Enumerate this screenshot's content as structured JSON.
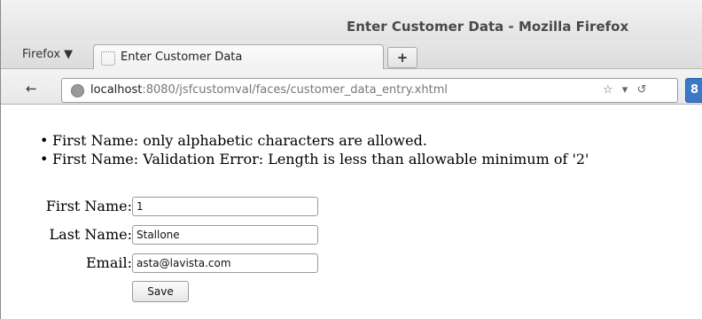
{
  "window": {
    "title": "Enter Customer Data - Mozilla Firefox",
    "firefox_menu": "Firefox ▼"
  },
  "tabs": [
    {
      "label": "Enter Customer Data",
      "active": true
    }
  ],
  "newtab": {
    "label": "+"
  },
  "navbar": {
    "back_icon": "←",
    "url_host": "localhost",
    "url_rest": ":8080/jsfcustomval/faces/customer_data_entry.xhtml",
    "star_icon": "☆",
    "dropdown_icon": "▾",
    "reload_icon": "↺",
    "search_engine_letter": "8"
  },
  "page": {
    "errors": [
      "First Name: only alphabetic characters are allowed.",
      "First Name: Validation Error: Length is less than allowable minimum of '2'"
    ],
    "form": {
      "first_name": {
        "label": "First Name:",
        "value": "1"
      },
      "last_name": {
        "label": "Last Name:",
        "value": "Stallone"
      },
      "email": {
        "label": "Email:",
        "value": "asta@lavista.com"
      },
      "save_label": "Save"
    }
  }
}
